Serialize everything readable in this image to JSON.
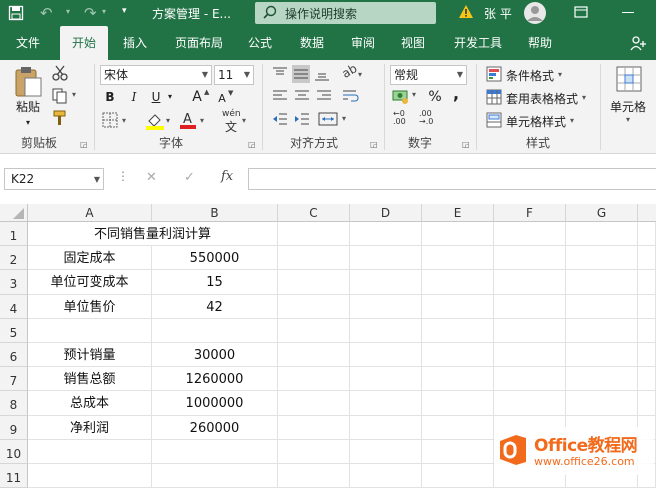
{
  "title_bar": {
    "doc_title": "方案管理 - E...",
    "search_placeholder": "操作说明搜索",
    "user": "张 平"
  },
  "menu": [
    "文件",
    "开始",
    "插入",
    "页面布局",
    "公式",
    "数据",
    "审阅",
    "视图",
    "开发工具",
    "帮助"
  ],
  "ribbon": {
    "font_name": "宋体",
    "font_size": "11",
    "number_format": "常规",
    "groups": [
      "剪贴板",
      "字体",
      "对齐方式",
      "数字",
      "样式"
    ],
    "paste_label": "粘贴",
    "cond_format": "条件格式",
    "table_format": "套用表格格式",
    "cell_style": "单元格样式",
    "cells_label": "单元格",
    "bold": "B",
    "italic": "I",
    "underline": "U",
    "increase_font": "A",
    "decrease_font": "A",
    "wen": "wén",
    "percent": "%",
    "comma": ","
  },
  "formula_bar": {
    "name_box": "K22",
    "fx": "fx",
    "cancel": "✕",
    "confirm": "✓"
  },
  "columns": [
    "A",
    "B",
    "C",
    "D",
    "E",
    "F",
    "G"
  ],
  "rows": [
    "1",
    "2",
    "3",
    "4",
    "5",
    "6",
    "7",
    "8",
    "9",
    "10",
    "11"
  ],
  "cells": [
    [
      "不同销售量利润计算",
      ""
    ],
    [
      "固定成本",
      "550000"
    ],
    [
      "单位可变成本",
      "15"
    ],
    [
      "单位售价",
      "42"
    ],
    [
      "",
      ""
    ],
    [
      "预计销量",
      "30000"
    ],
    [
      "销售总额",
      "1260000"
    ],
    [
      "总成本",
      "1000000"
    ],
    [
      "净利润",
      "260000"
    ],
    [
      "",
      ""
    ],
    [
      "",
      ""
    ]
  ],
  "watermark": {
    "brand": "Office教程网",
    "url": "www.office26.com"
  },
  "colors": {
    "excel_green": "#217346",
    "watermark_orange": "#f26b1d"
  }
}
